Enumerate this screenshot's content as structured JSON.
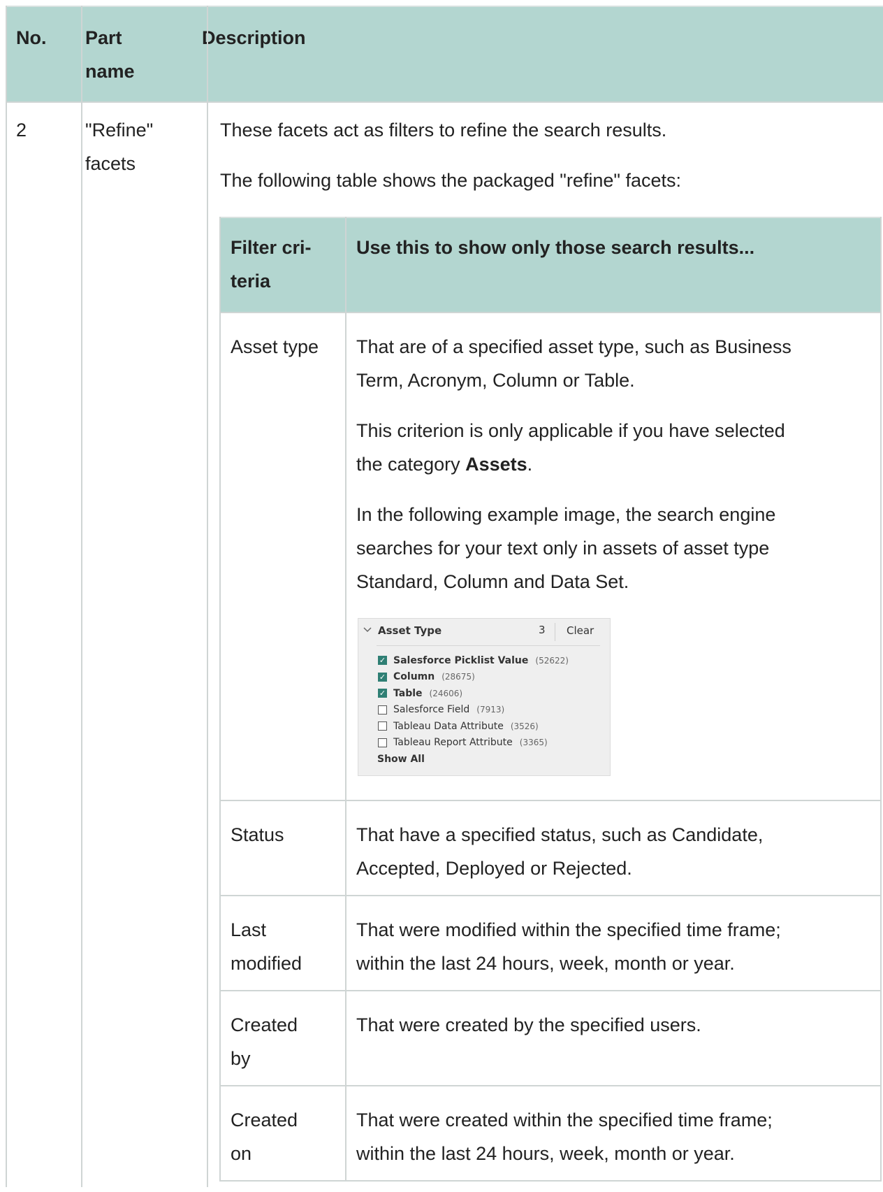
{
  "outer_table": {
    "headers": {
      "no": "No.",
      "part_line1": "Part",
      "part_line2": "name",
      "description": "Description"
    },
    "row": {
      "no": "2",
      "part_line1": "\"Refine\"",
      "part_line2": "facets",
      "intro1": "These facets act as filters to refine the search results.",
      "intro2": "The following table shows the packaged \"refine\" facets:"
    }
  },
  "inner_table": {
    "headers": {
      "criteria_line1": "Filter cri-",
      "criteria_line2": "teria",
      "use": "Use this to show only those search results..."
    },
    "asset_type": {
      "criterion": "Asset type",
      "p1_line1": "That are of a specified asset type, such as Business",
      "p1_line2": "Term, Acronym, Column or Table.",
      "p2_line1": "This criterion is only applicable if you have selected",
      "p2_line2_pre": "the category ",
      "p2_line2_bold": "Assets",
      "p2_line2_post": ".",
      "p3_line1": "In the following example image, the search engine",
      "p3_line2": "searches for your text only in assets of asset type",
      "p3_line3": "Standard, Column and Data Set."
    },
    "status": {
      "criterion": "Status",
      "line1": "That have a specified status, such as Candidate,",
      "line2": "Accepted, Deployed or Rejected."
    },
    "last_modified": {
      "criterion_line1": "Last",
      "criterion_line2": "modified",
      "line1": "That were modified within the specified time frame;",
      "line2": "within the last 24 hours, week, month or year."
    },
    "created_by": {
      "criterion_line1": "Created",
      "criterion_line2": "by",
      "line1": "That were created by the specified users."
    },
    "created_on": {
      "criterion_line1": "Created",
      "criterion_line2": "on",
      "line1": "That were created within the specified time frame;",
      "line2": "within the last 24 hours, week, month or year."
    }
  },
  "facet_widget": {
    "title": "Asset Type",
    "selected_count": "3",
    "clear_label": "Clear",
    "show_all_label": "Show All",
    "check_color": "#2f7f74",
    "items": [
      {
        "label": "Salesforce Picklist Value",
        "count": "(52622)",
        "checked": true
      },
      {
        "label": "Column",
        "count": "(28675)",
        "checked": true
      },
      {
        "label": "Table",
        "count": "(24606)",
        "checked": true
      },
      {
        "label": "Salesforce Field",
        "count": "(7913)",
        "checked": false
      },
      {
        "label": "Tableau Data Attribute",
        "count": "(3526)",
        "checked": false
      },
      {
        "label": "Tableau Report Attribute",
        "count": "(3365)",
        "checked": false
      }
    ]
  },
  "colors": {
    "header_bg": "#b3d6d0",
    "border": "#cfd5d4"
  }
}
